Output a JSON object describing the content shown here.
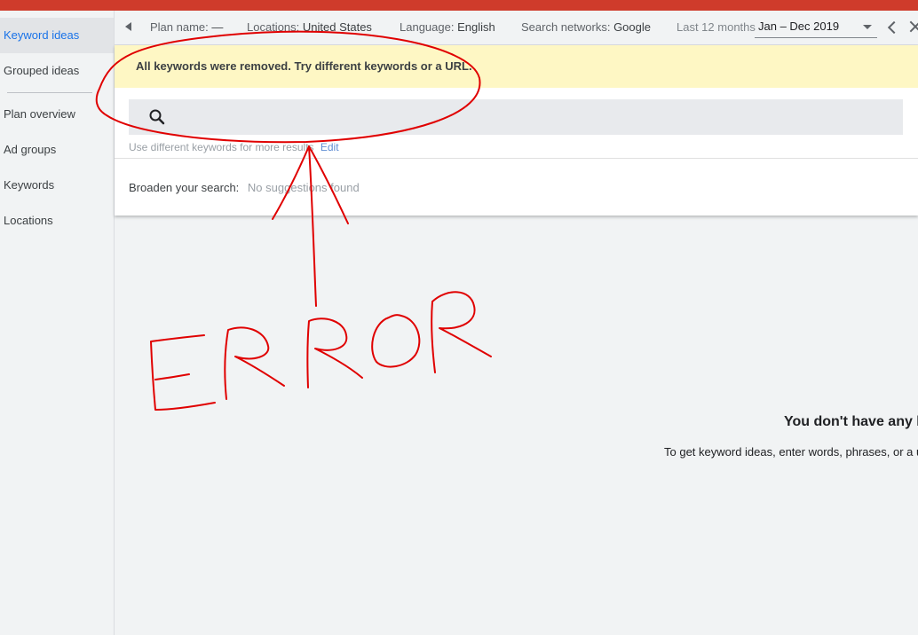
{
  "sidebar": {
    "items": [
      {
        "label": "Keyword ideas",
        "active": true
      },
      {
        "label": "Grouped ideas"
      },
      {
        "label": "Plan overview"
      },
      {
        "label": "Ad groups"
      },
      {
        "label": "Keywords"
      },
      {
        "label": "Locations"
      }
    ]
  },
  "filterbar": {
    "plan_name_label": "Plan name:",
    "plan_name_value": "—",
    "locations_label": "Locations:",
    "locations_value": "United States",
    "language_label": "Language:",
    "language_value": "English",
    "networks_label": "Search networks:",
    "networks_value": "Google",
    "period_label": "Last 12 months",
    "date_range": "Jan – Dec 2019"
  },
  "alert": {
    "text": "All keywords were removed. Try different keywords or a URL."
  },
  "search": {
    "value": "",
    "hint": "Use different keywords for more results",
    "edit_label": "Edit"
  },
  "broaden": {
    "label": "Broaden your search:",
    "value": "No suggestions found"
  },
  "empty_state": {
    "title": "You don't have any ke",
    "subtitle": "To get keyword ideas, enter words, phrases, or a u"
  },
  "annotation": {
    "text": "ERROR",
    "color": "#e00000"
  },
  "colors": {
    "topbar": "#cf3b2b",
    "alert_bg": "#fef7c4",
    "active_item": "#1a73e8"
  },
  "icons": [
    "collapse-arrow-icon",
    "search-icon",
    "chevron-down-icon",
    "chevron-left-icon",
    "close-icon"
  ]
}
